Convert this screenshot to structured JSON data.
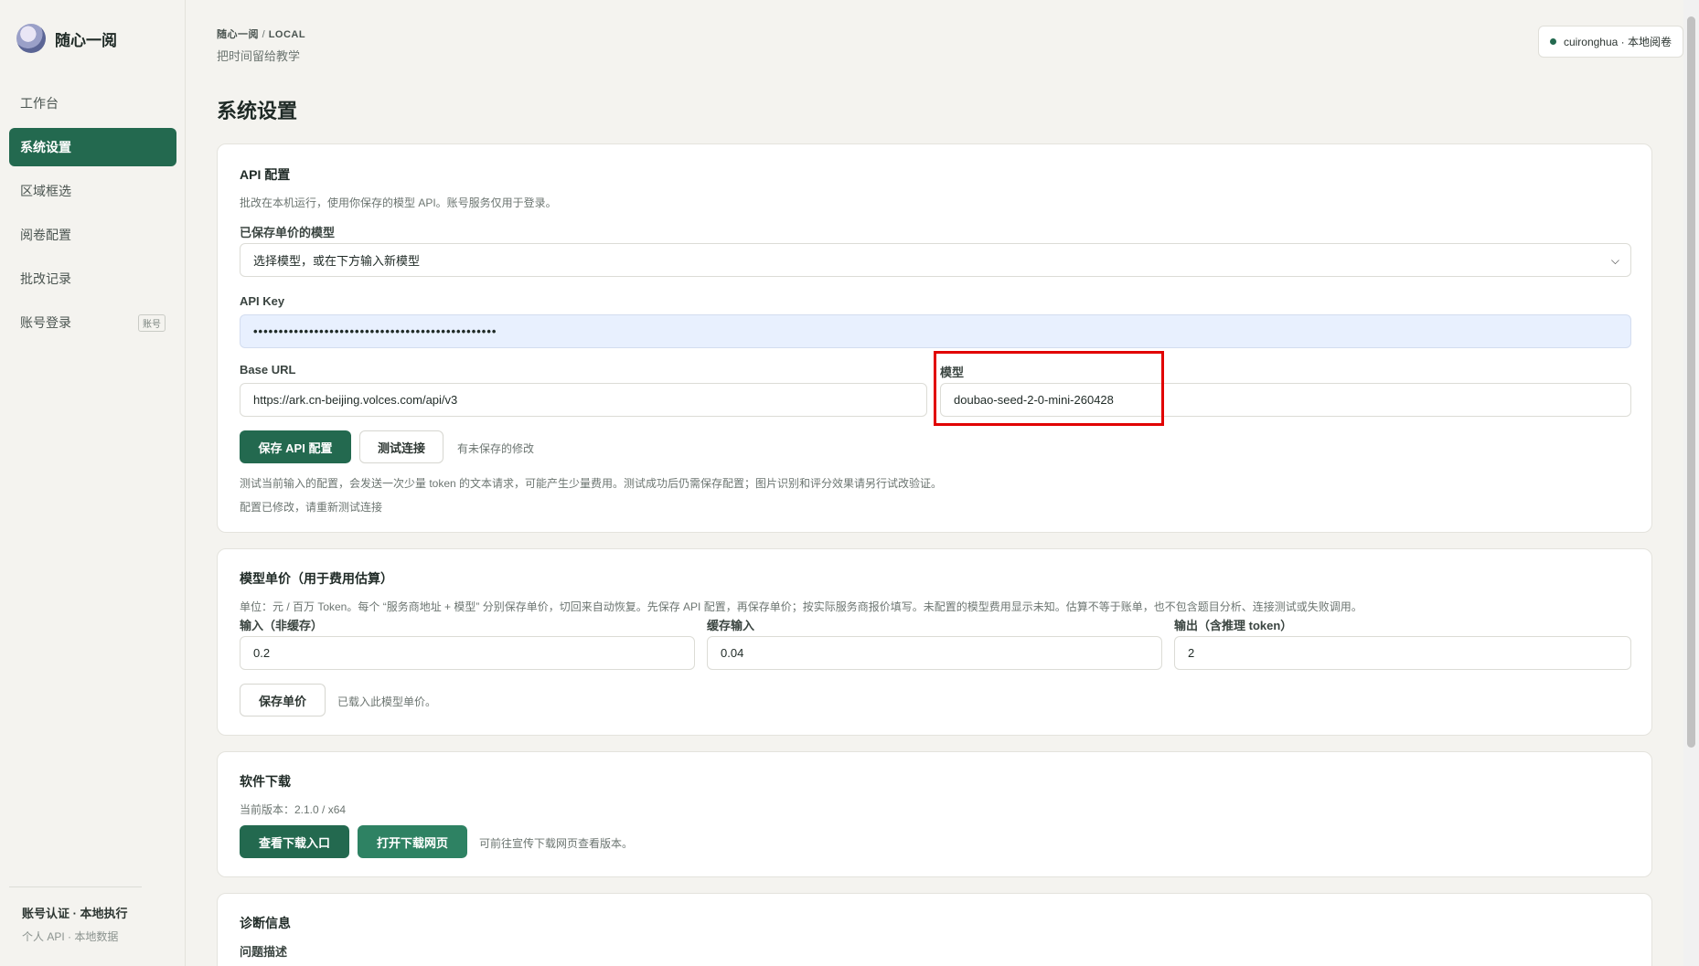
{
  "app": {
    "name": "随心一阅"
  },
  "sidebar": {
    "items": [
      {
        "label": "工作台"
      },
      {
        "label": "系统设置"
      },
      {
        "label": "区域框选"
      },
      {
        "label": "阅卷配置"
      },
      {
        "label": "批改记录"
      },
      {
        "label": "账号登录",
        "tag": "账号"
      }
    ],
    "footer": {
      "title": "账号认证 · 本地执行",
      "subtitle": "个人 API · 本地数据"
    }
  },
  "header": {
    "breadcrumb_app": "随心一阅",
    "breadcrumb_sep": "/",
    "breadcrumb_scope": "LOCAL",
    "subtitle": "把时间留给教学",
    "user_label": "cuironghua · 本地阅卷",
    "status_color": "#23694f"
  },
  "page": {
    "title": "系统设置"
  },
  "api_card": {
    "title": "API 配置",
    "hint": "批改在本机运行，使用你保存的模型 API。账号服务仅用于登录。",
    "saved_models_label": "已保存单价的模型",
    "saved_models_value": "选择模型，或在下方输入新模型",
    "api_key_label": "API Key",
    "api_key_value": "••••••••••••••••••••••••••••••••••••••••••••••••",
    "base_url_label": "Base URL",
    "base_url_value": "https://ark.cn-beijing.volces.com/api/v3",
    "model_label": "模型",
    "model_value": "doubao-seed-2-0-mini-260428",
    "save_button": "保存 API 配置",
    "test_button": "测试连接",
    "unsaved_note": "有未保存的修改",
    "test_hint": "测试当前输入的配置，会发送一次少量 token 的文本请求，可能产生少量费用。测试成功后仍需保存配置；图片识别和评分效果请另行试改验证。",
    "modified_note": "配置已修改，请重新测试连接"
  },
  "price_card": {
    "title": "模型单价（用于费用估算）",
    "hint": "单位：元 / 百万 Token。每个 “服务商地址 + 模型” 分别保存单价，切回来自动恢复。先保存 API 配置，再保存单价；按实际服务商报价填写。未配置的模型费用显示未知。估算不等于账单，也不包含题目分析、连接测试或失败调用。",
    "input_label": "输入（非缓存）",
    "input_value": "0.2",
    "cached_label": "缓存输入",
    "cached_value": "0.04",
    "output_label": "输出（含推理 token）",
    "output_value": "2",
    "save_button": "保存单价",
    "loaded_note": "已载入此模型单价。"
  },
  "download_card": {
    "title": "软件下载",
    "version": "当前版本：2.1.0 / x64",
    "view_button": "查看下载入口",
    "open_button": "打开下载网页",
    "note": "可前往宣传下载网页查看版本。"
  },
  "diag_card": {
    "title": "诊断信息",
    "problem_label": "问题描述"
  },
  "colors": {
    "accent": "#23694f",
    "highlight": "#e10000"
  }
}
